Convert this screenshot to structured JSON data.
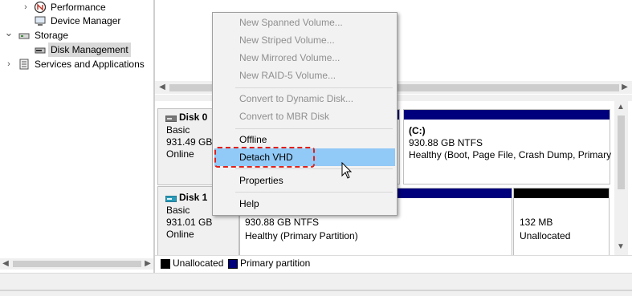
{
  "tree": {
    "items": [
      {
        "label": "Performance",
        "expander": "›"
      },
      {
        "label": "Device Manager",
        "expander": ""
      },
      {
        "label": "Storage",
        "expander": "⌄"
      },
      {
        "label": "Disk Management",
        "expander": ""
      },
      {
        "label": "Services and Applications",
        "expander": "›"
      }
    ]
  },
  "disks": [
    {
      "name": "Disk 0",
      "type": "Basic",
      "size": "931.49 GB",
      "status": "Online"
    },
    {
      "name": "Disk 1",
      "type": "Basic",
      "size": "931.01 GB",
      "status": "Online"
    }
  ],
  "partitions": {
    "disk0_c": {
      "label": "(C:)",
      "fs": "930.88 GB NTFS",
      "status": "Healthy (Boot, Page File, Crash Dump, Primary"
    },
    "disk1_primary": {
      "fs": "930.88 GB NTFS",
      "status": "Healthy (Primary Partition)"
    },
    "disk1_unalloc": {
      "size": "132 MB",
      "status": "Unallocated"
    }
  },
  "legend": {
    "unallocated": "Unallocated",
    "primary": "Primary partition"
  },
  "menu": {
    "items": [
      "New Spanned Volume...",
      "New Striped Volume...",
      "New Mirrored Volume...",
      "New RAID-5 Volume...",
      "Convert to Dynamic Disk...",
      "Convert to MBR Disk",
      "Offline",
      "Detach VHD",
      "Properties",
      "Help"
    ]
  },
  "colors": {
    "primary_partition": "#00007c",
    "unallocated": "#000000",
    "menu_highlight": "#91c9f7",
    "callout": "#e0201b"
  }
}
